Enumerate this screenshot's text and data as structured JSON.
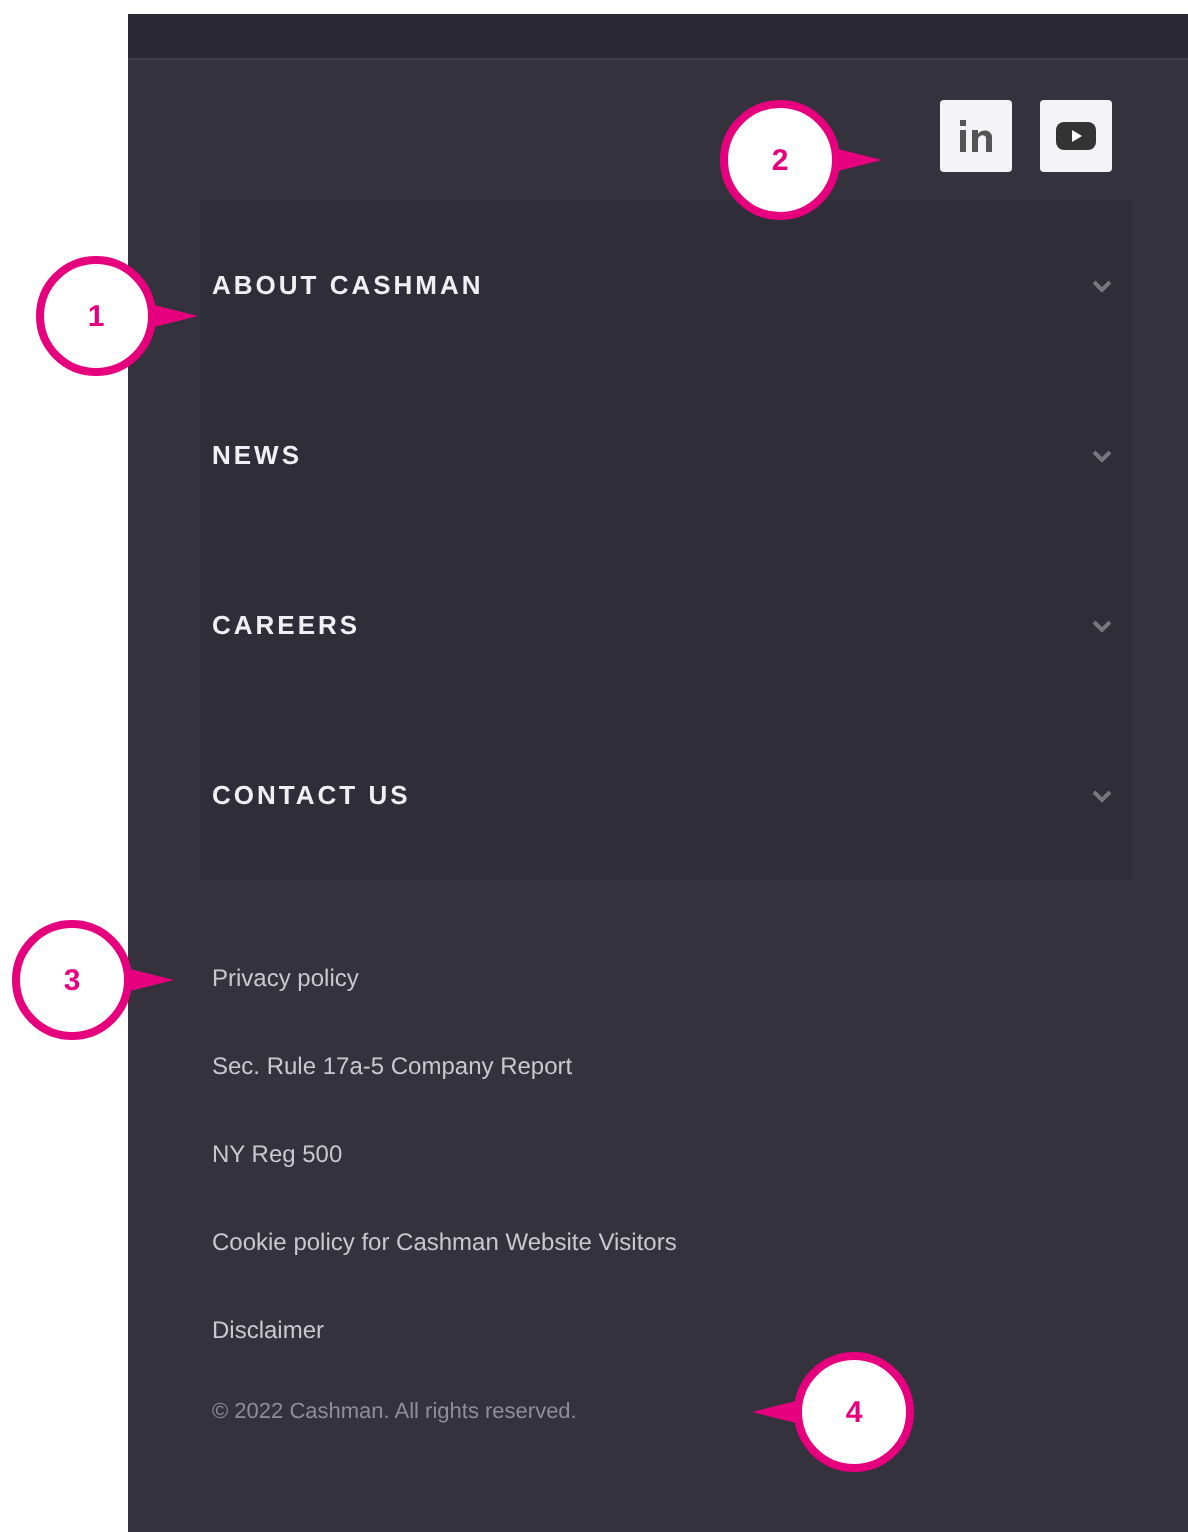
{
  "social_links": [
    {
      "kind": "linkedin"
    },
    {
      "kind": "youtube"
    }
  ],
  "menu": [
    {
      "label": "ABOUT CASHMAN",
      "expanded": false
    },
    {
      "label": "NEWS",
      "expanded": false
    },
    {
      "label": "CAREERS",
      "expanded": false
    },
    {
      "label": "CONTACT US",
      "expanded": false
    }
  ],
  "footer_links": [
    "Privacy policy",
    "Sec. Rule 17a-5 Company Report",
    "NY Reg 500",
    "Cookie policy for Cashman Website Visitors",
    "Disclaimer"
  ],
  "copyright": "© 2022 Cashman. All rights reserved.",
  "callouts": [
    {
      "number": "1",
      "kind": "rightward"
    },
    {
      "number": "2",
      "kind": "rightward"
    },
    {
      "number": "3",
      "kind": "rightward"
    },
    {
      "number": "4",
      "kind": "leftward"
    }
  ]
}
